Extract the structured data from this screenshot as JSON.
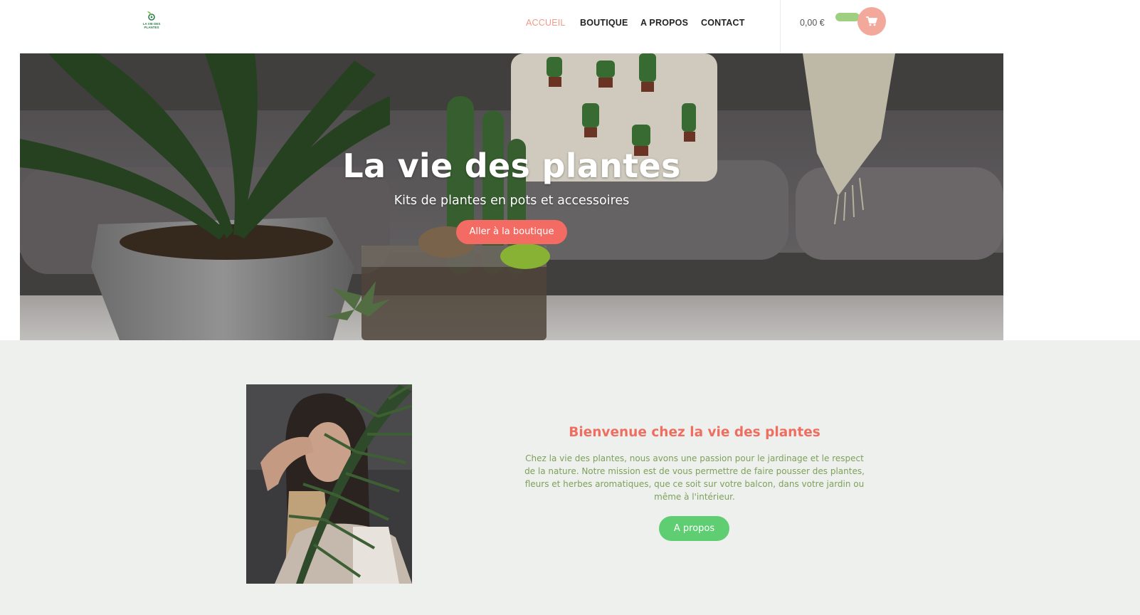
{
  "header": {
    "logo": {
      "text": "LA VIE DES PLANTES",
      "icon": "leaf-logo-icon",
      "color": "#2f7d50"
    },
    "nav": [
      {
        "label": "ACCUEIL",
        "active": true
      },
      {
        "label": "BOUTIQUE",
        "active": false
      },
      {
        "label": "A PROPOS",
        "active": false
      },
      {
        "label": "CONTACT",
        "active": false
      }
    ],
    "cart": {
      "total": "0,00 €",
      "icon": "shopping-cart-icon",
      "color": "#f2a89b"
    }
  },
  "hero": {
    "title": "La vie des plantes",
    "subtitle": "Kits de plantes en pots et accessoires",
    "button_label": "Aller à la boutique",
    "button_color": "#f36b63"
  },
  "welcome": {
    "title": "Bienvenue chez la vie des plantes",
    "text": "Chez la vie des plantes, nous avons une passion pour le jardinage et le respect de la nature. Notre mission est de vous permettre de faire pousser des plantes, fleurs et herbes aromatiques, que ce soit sur votre balcon, dans votre jardin ou même à l'intérieur.",
    "button_label": "A propos",
    "button_color": "#5fce72",
    "title_color": "#f06e61",
    "text_color": "#7ea05c",
    "background": "#edf0ec"
  }
}
